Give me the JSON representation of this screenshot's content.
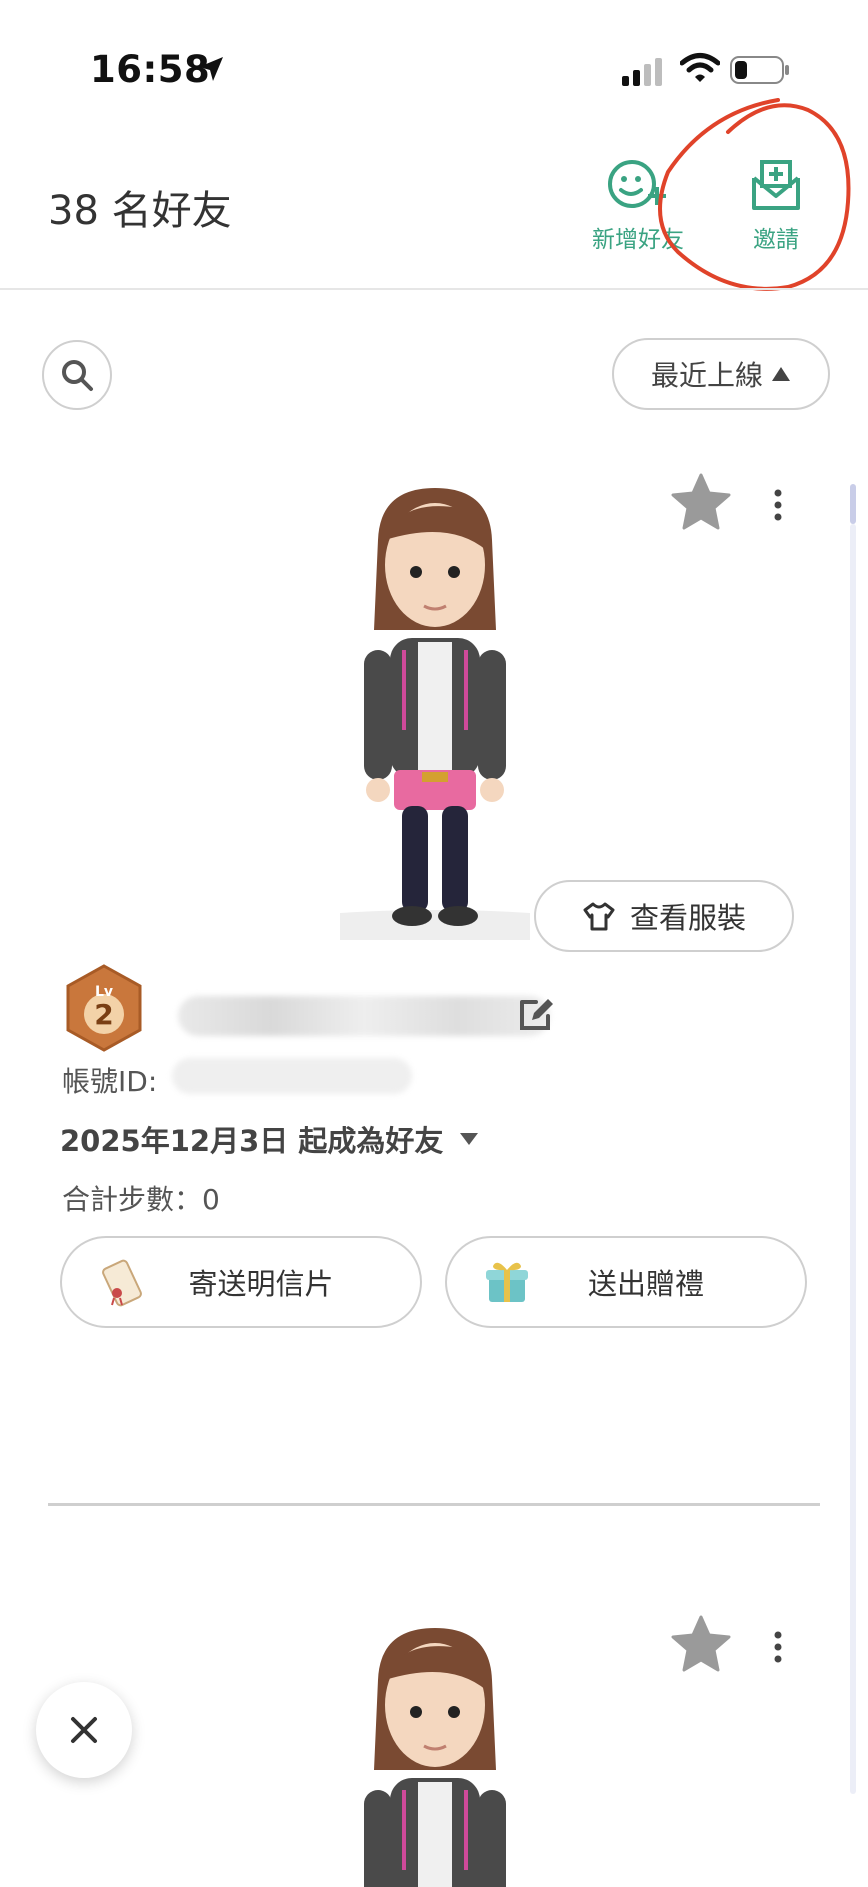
{
  "status_bar": {
    "time": "16:58"
  },
  "header": {
    "title": "38 名好友",
    "add_friend_label": "新增好友",
    "invite_label": "邀請"
  },
  "toolbar": {
    "sort_label": "最近上線"
  },
  "friend_card": {
    "outfit_label": "查看服裝",
    "level": "2",
    "level_prefix": "Lv",
    "account_id_label": "帳號ID:",
    "friends_since": "2025年12月3日 起成為好友",
    "steps": "合計步數：0",
    "postcard_label": "寄送明信片",
    "gift_label": "送出贈禮"
  },
  "colors": {
    "accent_green": "#3aa382",
    "annotation_red": "#e0432a",
    "star_gray": "#9a9a9a"
  },
  "icons": [
    "location-arrow-icon",
    "signal-icon",
    "wifi-icon",
    "battery-icon",
    "add-friend-icon",
    "invite-icon",
    "search-icon",
    "sort-arrow-icon",
    "star-icon",
    "more-icon",
    "shirt-icon",
    "edit-icon",
    "dropdown-icon",
    "postcard-icon",
    "gift-icon",
    "close-icon"
  ]
}
